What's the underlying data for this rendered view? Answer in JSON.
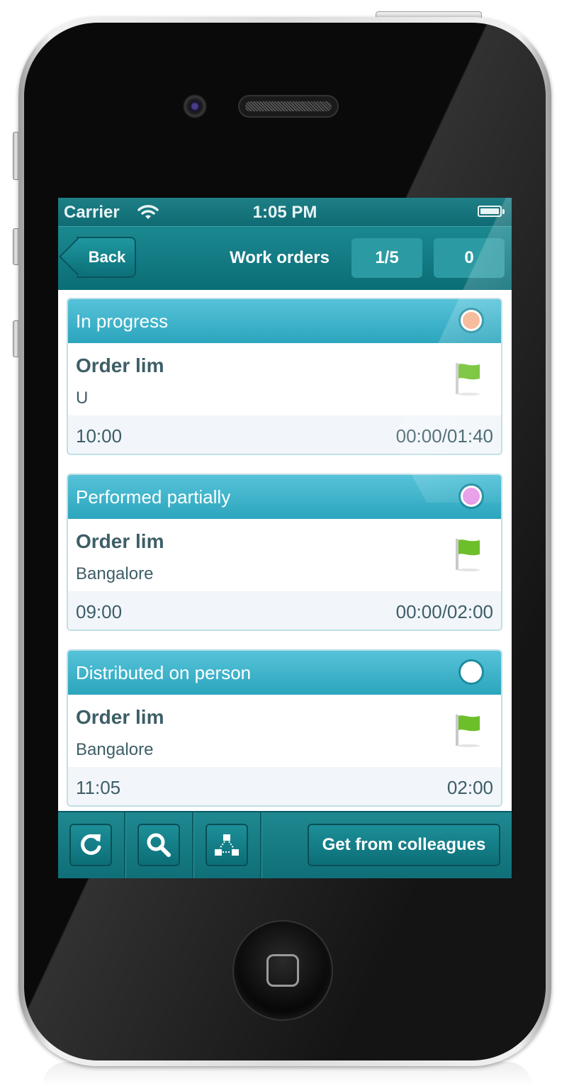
{
  "status_bar": {
    "carrier": "Carrier",
    "time": "1:05 PM"
  },
  "nav": {
    "back_label": "Back",
    "title": "Work orders",
    "page_indicator": "1/5",
    "count": "0"
  },
  "orders": [
    {
      "status": "In progress",
      "status_color": "#f4b08c",
      "title": "Order lim",
      "location": "U",
      "time": "10:00",
      "duration": "00:00/01:40"
    },
    {
      "status": "Performed partially",
      "status_color": "#e79be8",
      "title": "Order lim",
      "location": "Bangalore",
      "time": "09:00",
      "duration": "00:00/02:00"
    },
    {
      "status": "Distributed on person",
      "status_color": "#ffffff",
      "title": "Order lim",
      "location": "Bangalore",
      "time": "11:05",
      "duration": "02:00"
    }
  ],
  "toolbar": {
    "refresh_icon": "refresh-icon",
    "search_icon": "search-icon",
    "share_icon": "network-share-icon",
    "get_from_colleagues_label": "Get from colleagues"
  },
  "colors": {
    "accent": "#0f6b73",
    "header_teal": "#2ba5bd",
    "flag_green": "#6cbf2a"
  }
}
